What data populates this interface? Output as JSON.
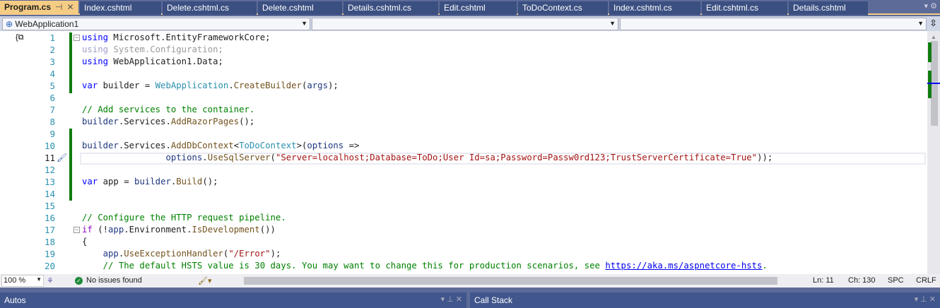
{
  "tabs": [
    {
      "label": "Program.cs",
      "active": true
    },
    {
      "label": "Index.cshtml"
    },
    {
      "label": "Delete.cshtml.cs"
    },
    {
      "label": "Delete.cshtml"
    },
    {
      "label": "Details.cshtml.cs"
    },
    {
      "label": "Edit.cshtml"
    },
    {
      "label": "ToDoContext.cs"
    },
    {
      "label": "Index.cshtml.cs"
    },
    {
      "label": "Edit.cshtml.cs"
    },
    {
      "label": "Details.cshtml"
    }
  ],
  "navbar": {
    "project": "WebApplication1",
    "type": "",
    "member": ""
  },
  "editor": {
    "current_line": 11,
    "lines": [
      [
        [
          "using",
          "kw"
        ],
        [
          " Microsoft.EntityFrameworkCore;",
          ""
        ]
      ],
      [
        [
          "using",
          "gr"
        ],
        [
          " System.Configuration;",
          "grt"
        ]
      ],
      [
        [
          "using",
          "kw"
        ],
        [
          " WebApplication1.Data;",
          ""
        ]
      ],
      [],
      [
        [
          "var",
          "kw"
        ],
        [
          " builder = ",
          ""
        ],
        [
          "WebApplication",
          "ty"
        ],
        [
          ".",
          ""
        ],
        [
          "CreateBuilder",
          "me"
        ],
        [
          "(",
          ""
        ],
        [
          "args",
          "va"
        ],
        [
          ");",
          ""
        ]
      ],
      [],
      [
        [
          "// Add services to the container.",
          "cm"
        ]
      ],
      [
        [
          "builder",
          "va"
        ],
        [
          ".Services.",
          ""
        ],
        [
          "AddRazorPages",
          "me"
        ],
        [
          "();",
          ""
        ]
      ],
      [],
      [
        [
          "builder",
          "va"
        ],
        [
          ".Services.",
          ""
        ],
        [
          "AddDbContext",
          "me"
        ],
        [
          "<",
          ""
        ],
        [
          "ToDoContext",
          "ty"
        ],
        [
          ">(",
          ""
        ],
        [
          "options",
          "va"
        ],
        [
          " =>",
          ""
        ]
      ],
      [
        [
          "                ",
          ""
        ],
        [
          "options",
          "va"
        ],
        [
          ".",
          ""
        ],
        [
          "UseSqlServer",
          "me"
        ],
        [
          "(",
          ""
        ],
        [
          "\"Server=localhost;Database=ToDo;User Id=sa;Password=Passw0rd123;TrustServerCertificate=True\"",
          "st"
        ],
        [
          "));",
          ""
        ]
      ],
      [],
      [
        [
          "var",
          "kw"
        ],
        [
          " app = ",
          ""
        ],
        [
          "builder",
          "va"
        ],
        [
          ".",
          ""
        ],
        [
          "Build",
          "me"
        ],
        [
          "();",
          ""
        ]
      ],
      [],
      [],
      [
        [
          "// Configure the HTTP request pipeline.",
          "cm"
        ]
      ],
      [
        [
          "if",
          "ctl"
        ],
        [
          " (!",
          ""
        ],
        [
          "app",
          "va"
        ],
        [
          ".Environment.",
          ""
        ],
        [
          "IsDevelopment",
          "me"
        ],
        [
          "())",
          ""
        ]
      ],
      [
        [
          "{",
          ""
        ]
      ],
      [
        [
          "    ",
          ""
        ],
        [
          "app",
          "va"
        ],
        [
          ".",
          ""
        ],
        [
          "UseExceptionHandler",
          "me"
        ],
        [
          "(",
          ""
        ],
        [
          "\"/Error\"",
          "st"
        ],
        [
          ");",
          ""
        ]
      ],
      [
        [
          "    // The default HSTS value is 30 days. You may want to change this for production scenarios, see ",
          "cm"
        ],
        [
          "https://aka.ms/aspnetcore-hsts",
          "cm"
        ],
        [
          ".",
          "cm"
        ]
      ]
    ]
  },
  "status": {
    "zoom": "100 %",
    "issues": "No issues found",
    "line": "Ln: 11",
    "col": "Ch: 130",
    "spacing": "SPC",
    "eol": "CRLF"
  },
  "panels": {
    "left": "Autos",
    "right": "Call Stack"
  },
  "colors": {
    "accent_tab": "#f5cc84",
    "tab_bg": "#3b4f81",
    "change_bar": "#107c10"
  }
}
